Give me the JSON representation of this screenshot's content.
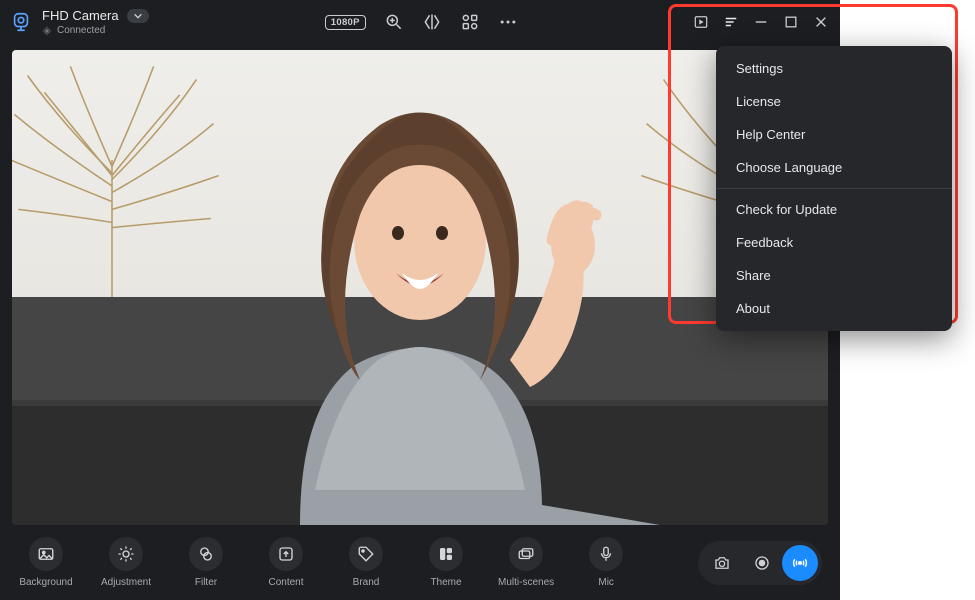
{
  "header": {
    "title": "FHD Camera",
    "status_label": "Connected",
    "resolution_badge": "1080P"
  },
  "toolbar": {
    "tools": [
      {
        "label": "Background"
      },
      {
        "label": "Adjustment"
      },
      {
        "label": "Filter"
      },
      {
        "label": "Content"
      },
      {
        "label": "Brand"
      },
      {
        "label": "Theme"
      },
      {
        "label": "Multi-scenes"
      },
      {
        "label": "Mic"
      }
    ]
  },
  "menu": {
    "group1": [
      "Settings",
      "License",
      "Help Center",
      "Choose Language"
    ],
    "group2": [
      "Check for Update",
      "Feedback",
      "Share",
      "About"
    ]
  }
}
